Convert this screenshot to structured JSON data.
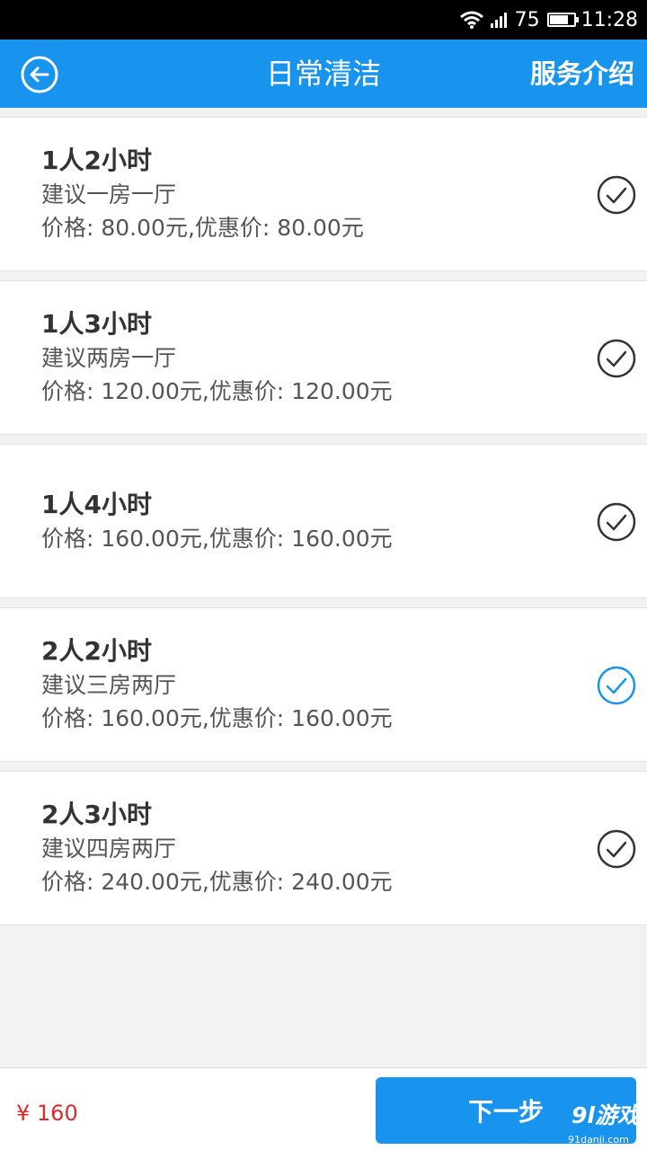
{
  "status_bar": {
    "signal_text": "75",
    "time": "11:28"
  },
  "app_bar": {
    "title": "日常清洁",
    "right_link": "服务介绍"
  },
  "items": [
    {
      "title": "1人2小时",
      "suggestion": "建议一房一厅",
      "price": "价格: 80.00元,优惠价: 80.00元",
      "selected": false
    },
    {
      "title": "1人3小时",
      "suggestion": "建议两房一厅",
      "price": "价格: 120.00元,优惠价: 120.00元",
      "selected": false
    },
    {
      "title": "1人4小时",
      "suggestion": "",
      "price": "价格: 160.00元,优惠价: 160.00元",
      "selected": false
    },
    {
      "title": "2人2小时",
      "suggestion": "建议三房两厅",
      "price": "价格: 160.00元,优惠价: 160.00元",
      "selected": true
    },
    {
      "title": "2人3小时",
      "suggestion": "建议四房两厅",
      "price": "价格: 240.00元,优惠价: 240.00元",
      "selected": false
    }
  ],
  "bottom_bar": {
    "total": "¥ 160",
    "next_label": "下一步"
  },
  "watermark": {
    "brand": "9l游戏",
    "site": "91danji.com"
  },
  "colors": {
    "primary": "#1894ee",
    "price_red": "#e02a2a",
    "check_gray": "#333333"
  }
}
